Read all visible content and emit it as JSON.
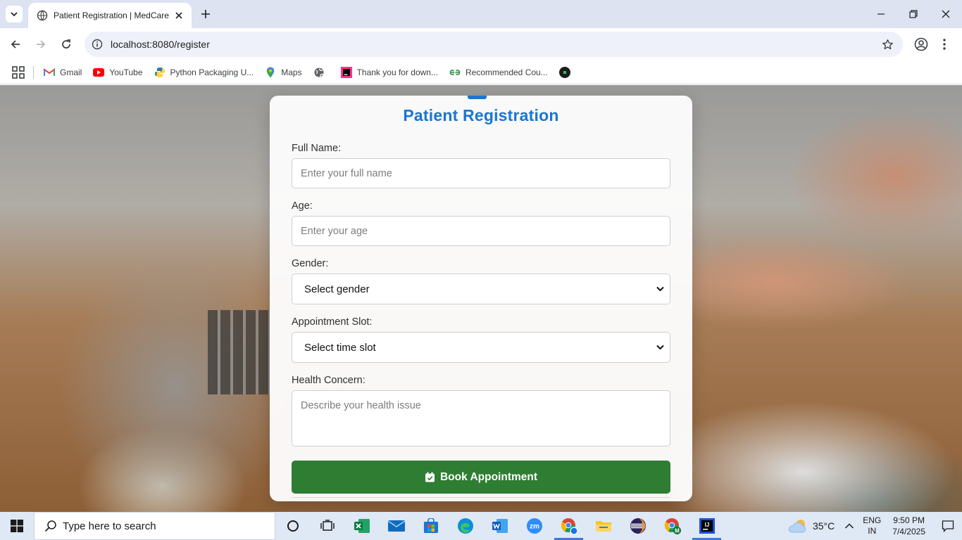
{
  "browser": {
    "tab_title": "Patient Registration | MedCare",
    "url": "localhost:8080/register",
    "bookmarks": [
      {
        "label": "Gmail",
        "icon": "gmail-icon"
      },
      {
        "label": "YouTube",
        "icon": "youtube-icon"
      },
      {
        "label": "Python Packaging U...",
        "icon": "python-icon"
      },
      {
        "label": "Maps",
        "icon": "maps-icon"
      },
      {
        "label": "",
        "icon": "globe-icon"
      },
      {
        "label": "Thank you for down...",
        "icon": "jetbrains-icon"
      },
      {
        "label": "Recommended Cou...",
        "icon": "gfg-icon"
      },
      {
        "label": "",
        "icon": "dark-circle-icon"
      }
    ]
  },
  "form": {
    "title": "Patient Registration",
    "full_name_label": "Full Name:",
    "full_name_placeholder": "Enter your full name",
    "age_label": "Age:",
    "age_placeholder": "Enter your age",
    "gender_label": "Gender:",
    "gender_selected": "Select gender",
    "slot_label": "Appointment Slot:",
    "slot_selected": "Select time slot",
    "concern_label": "Health Concern:",
    "concern_placeholder": "Describe your health issue",
    "submit_label": "Book Appointment",
    "accent_color": "#1976d2",
    "button_color": "#2e7d32"
  },
  "taskbar": {
    "search_placeholder": "Type here to search",
    "apps": [
      "cortana",
      "task-view",
      "excel",
      "mail",
      "store",
      "edge",
      "word",
      "zoom",
      "chrome-profile",
      "file-explorer",
      "eclipse",
      "chrome",
      "intellij"
    ],
    "weather": "35°C",
    "lang_line1": "ENG",
    "lang_line2": "IN",
    "time": "9:50 PM",
    "date": "7/4/2025"
  }
}
